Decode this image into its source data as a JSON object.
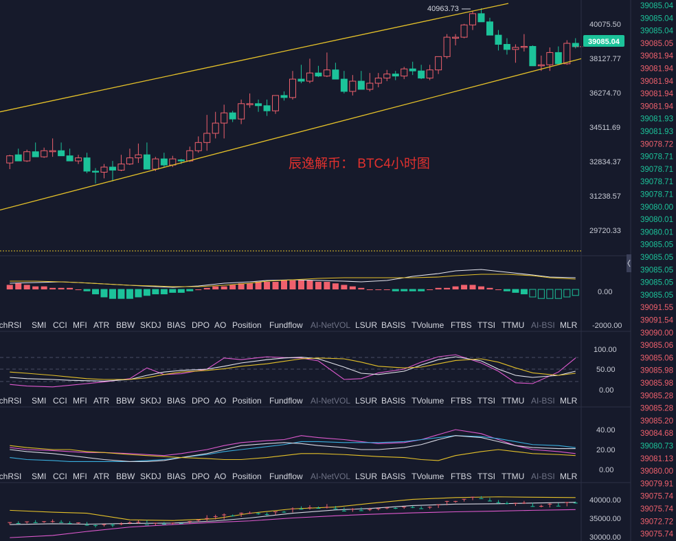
{
  "watermark": "辰逸解币： BTC4小时图",
  "high_label": "40963.73",
  "current_price": "39085.04",
  "indicator_tabs": [
    "ochRSI",
    "SMI",
    "CCI",
    "MFI",
    "ATR",
    "BBW",
    "SKDJ",
    "BIAS",
    "DPO",
    "AO",
    "Position",
    "Fundflow",
    "AI-NetVOL",
    "LSUR",
    "BASIS",
    "TVolume",
    "FTBS",
    "TTSI",
    "TTMU",
    "AI-BSI",
    "MLR"
  ],
  "dim_tabs": [
    "AI-NetVOL",
    "AI-BSI"
  ],
  "colors": {
    "background": "#161a2b",
    "up": "#f0616d",
    "down": "#1cc39a",
    "channel": "#e6c229",
    "dotted_line": "#e6c229",
    "price_tag": "#1cc39a"
  },
  "price_axis_labels": [
    "40075.50",
    "38127.77",
    "36274.70",
    "34511.69",
    "32834.37",
    "31238.57",
    "29720.33"
  ],
  "panel1_axis_labels": [
    "0.00",
    "-2000.00"
  ],
  "panel2_axis_labels": [
    "100.00",
    "50.00",
    "0.00"
  ],
  "panel3_axis_labels": [
    "40.00",
    "20.00",
    "0.00"
  ],
  "panel4_axis_labels": [
    "40000.00",
    "35000.00",
    "30000.00"
  ],
  "right_ticker": [
    {
      "p": "39085.04",
      "c": "g"
    },
    {
      "p": "39085.04",
      "c": "g"
    },
    {
      "p": "39085.04",
      "c": "g"
    },
    {
      "p": "39085.05",
      "c": "r"
    },
    {
      "p": "39081.94",
      "c": "r"
    },
    {
      "p": "39081.94",
      "c": "r"
    },
    {
      "p": "39081.94",
      "c": "r"
    },
    {
      "p": "39081.94",
      "c": "r"
    },
    {
      "p": "39081.94",
      "c": "r"
    },
    {
      "p": "39081.93",
      "c": "g"
    },
    {
      "p": "39081.93",
      "c": "g"
    },
    {
      "p": "39078.72",
      "c": "r"
    },
    {
      "p": "39078.71",
      "c": "g"
    },
    {
      "p": "39078.71",
      "c": "g"
    },
    {
      "p": "39078.71",
      "c": "g"
    },
    {
      "p": "39078.71",
      "c": "g"
    },
    {
      "p": "39080.00",
      "c": "g"
    },
    {
      "p": "39080.01",
      "c": "g"
    },
    {
      "p": "39080.01",
      "c": "g"
    },
    {
      "p": "39085.05",
      "c": "g"
    },
    {
      "p": "39085.05",
      "c": "g"
    },
    {
      "p": "39085.05",
      "c": "g"
    },
    {
      "p": "39085.05",
      "c": "g"
    },
    {
      "p": "39085.05",
      "c": "g"
    },
    {
      "p": "39091.55",
      "c": "r"
    },
    {
      "p": "39091.54",
      "c": "r"
    },
    {
      "p": "39090.00",
      "c": "r"
    },
    {
      "p": "39085.06",
      "c": "r"
    },
    {
      "p": "39085.06",
      "c": "r"
    },
    {
      "p": "39085.98",
      "c": "r"
    },
    {
      "p": "39085.98",
      "c": "r"
    },
    {
      "p": "39085.28",
      "c": "r"
    },
    {
      "p": "39085.28",
      "c": "r"
    },
    {
      "p": "39085.20",
      "c": "r"
    },
    {
      "p": "39084.68",
      "c": "r"
    },
    {
      "p": "39080.73",
      "c": "g"
    },
    {
      "p": "39081.13",
      "c": "r"
    },
    {
      "p": "39080.00",
      "c": "r"
    },
    {
      "p": "39079.91",
      "c": "r"
    },
    {
      "p": "39075.74",
      "c": "r"
    },
    {
      "p": "39075.74",
      "c": "r"
    },
    {
      "p": "39072.72",
      "c": "r"
    },
    {
      "p": "39075.74",
      "c": "r"
    }
  ],
  "chart_data": {
    "type": "candlestick",
    "symbol": "BTC",
    "interval": "4h",
    "ylim": [
      29000,
      41200
    ],
    "ohlc": [
      [
        33400,
        33800,
        33100,
        33750
      ],
      [
        33800,
        34100,
        33600,
        33500
      ],
      [
        33500,
        34050,
        33450,
        33950
      ],
      [
        33950,
        34400,
        33700,
        33700
      ],
      [
        33700,
        34150,
        33650,
        34000
      ],
      [
        34000,
        34600,
        33700,
        34000
      ],
      [
        34000,
        34400,
        33800,
        33750
      ],
      [
        33750,
        34100,
        33500,
        33500
      ],
      [
        33500,
        33800,
        33350,
        33650
      ],
      [
        33650,
        33900,
        32900,
        33000
      ],
      [
        33000,
        33150,
        32400,
        32950
      ],
      [
        32950,
        33350,
        32650,
        33200
      ],
      [
        33200,
        33500,
        32500,
        33050
      ],
      [
        33050,
        33800,
        33000,
        33350
      ],
      [
        33350,
        34100,
        33300,
        33650
      ],
      [
        33650,
        34350,
        33400,
        33800
      ],
      [
        33800,
        34400,
        33500,
        33100
      ],
      [
        33100,
        33700,
        33000,
        33600
      ],
      [
        33600,
        33900,
        33200,
        33300
      ],
      [
        33300,
        33750,
        33200,
        33600
      ],
      [
        33550,
        33600,
        33350,
        33500
      ],
      [
        33500,
        34200,
        33450,
        34000
      ],
      [
        34000,
        34700,
        33900,
        34400
      ],
      [
        34400,
        35750,
        34000,
        34850
      ],
      [
        34850,
        35900,
        34600,
        35350
      ],
      [
        35350,
        36250,
        34600,
        35850
      ],
      [
        35850,
        35950,
        35400,
        35550
      ],
      [
        35550,
        36500,
        35300,
        36300
      ],
      [
        36300,
        36800,
        36100,
        36300
      ],
      [
        36300,
        36500,
        35900,
        36200
      ],
      [
        36200,
        36500,
        35700,
        35950
      ],
      [
        35950,
        36700,
        35800,
        36700
      ],
      [
        36700,
        36900,
        36450,
        36600
      ],
      [
        36600,
        37900,
        36500,
        37500
      ],
      [
        37500,
        38200,
        37300,
        37400
      ],
      [
        37400,
        38500,
        37300,
        37800
      ],
      [
        37800,
        38150,
        37600,
        37650
      ],
      [
        37650,
        38800,
        37600,
        37950
      ],
      [
        37950,
        38300,
        37500,
        37500
      ],
      [
        37500,
        37900,
        36800,
        36900
      ],
      [
        36900,
        37700,
        36700,
        37400
      ],
      [
        37400,
        37900,
        37100,
        37000
      ],
      [
        37000,
        37800,
        36900,
        37300
      ],
      [
        37300,
        37800,
        37100,
        37550
      ],
      [
        37550,
        37950,
        37400,
        37750
      ],
      [
        37750,
        37900,
        37450,
        37650
      ],
      [
        37650,
        38100,
        37500,
        38000
      ],
      [
        38000,
        38350,
        37700,
        37900
      ],
      [
        37900,
        38200,
        37500,
        37550
      ],
      [
        37550,
        38200,
        37450,
        37950
      ],
      [
        37950,
        38600,
        37750,
        38600
      ],
      [
        38600,
        39700,
        38500,
        39550
      ],
      [
        39550,
        39700,
        39150,
        39550
      ],
      [
        39550,
        40200,
        39500,
        40150
      ],
      [
        40150,
        40850,
        39900,
        40700
      ],
      [
        40700,
        40964,
        40500,
        40300
      ],
      [
        40300,
        40500,
        39700,
        39650
      ],
      [
        39650,
        39900,
        38900,
        39200
      ],
      [
        39200,
        39500,
        38700,
        38950
      ],
      [
        38950,
        39200,
        38300,
        39050
      ],
      [
        39050,
        39700,
        38850,
        39100
      ],
      [
        39100,
        39150,
        38200,
        38150
      ],
      [
        38150,
        38650,
        37900,
        38200
      ],
      [
        38200,
        39050,
        37900,
        38800
      ],
      [
        38800,
        39100,
        38300,
        38250
      ],
      [
        38250,
        39400,
        38200,
        39250
      ],
      [
        39250,
        39500,
        39000,
        39085
      ]
    ],
    "channel_upper": [
      [
        0,
        35900
      ],
      [
        740,
        41200
      ]
    ],
    "channel_lower": [
      [
        0,
        31100
      ],
      [
        846,
        38500
      ]
    ],
    "dotted_level": 29100,
    "max_annotation": {
      "value": 40963.73,
      "label": "40963.73"
    },
    "last_price": 39085.04
  }
}
